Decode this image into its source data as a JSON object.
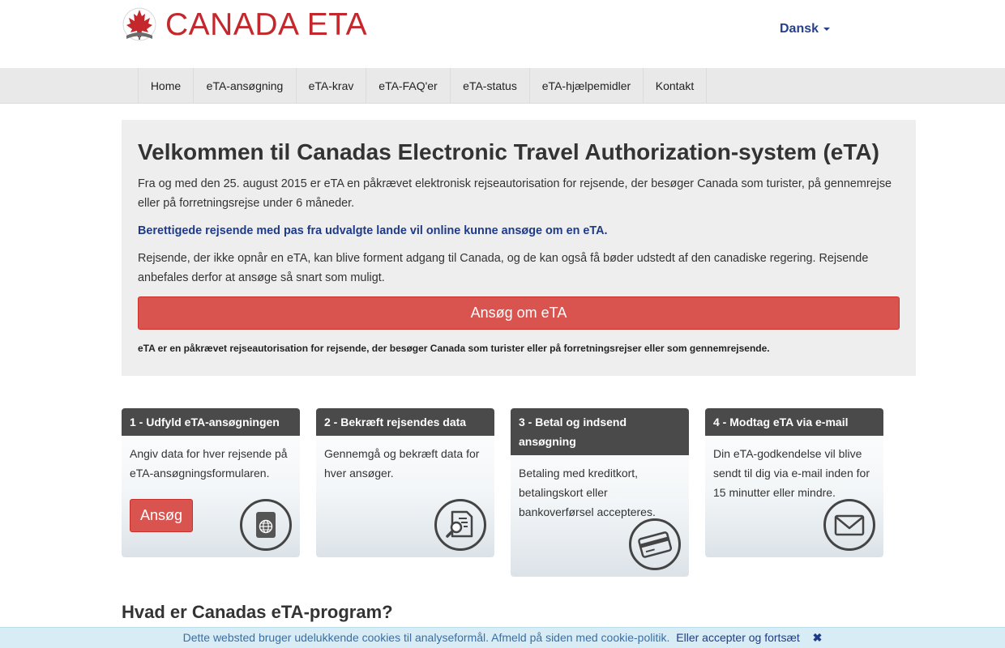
{
  "header": {
    "logo_text": "CANADA ETA",
    "language": "Dansk"
  },
  "nav": {
    "items": [
      "Home",
      "eTA-ansøgning",
      "eTA-krav",
      "eTA-FAQ'er",
      "eTA-status",
      "eTA-hjælpemidler",
      "Kontakt"
    ]
  },
  "hero": {
    "title": "Velkommen til Canadas Electronic Travel Authorization-system (eTA)",
    "p1": "Fra og med den 25. august 2015 er eTA en påkrævet elektronisk rejseautorisation for rejsende, der besøger Canada som turister, på gennemrejse eller på forretningsrejse under 6 måneder.",
    "p2": "Berettigede rejsende med pas fra udvalgte lande vil online kunne ansøge om en eTA.",
    "p3": "Rejsende, der ikke opnår en eTA, kan blive forment adgang til Canada, og de kan også få bøder udstedt af den canadiske regering. Rejsende anbefales derfor at ansøge så snart som muligt.",
    "apply_button": "Ansøg om eTA",
    "note": "eTA er en påkrævet rejseautorisation for rejsende, der besøger Canada som turister eller på forretningsrejser eller som gennemrejsende."
  },
  "steps": [
    {
      "title": "1 - Udfyld eTA-ansøgningen",
      "text": "Angiv data for hver rejsende på eTA-ansøgningsformularen.",
      "button": "Ansøg",
      "icon": "passport-icon"
    },
    {
      "title": "2 - Bekræft rejsendes data",
      "text": "Gennemgå og bekræft data for hver ansøger.",
      "icon": "document-search-icon"
    },
    {
      "title": "3 - Betal og indsend ansøgning",
      "text": "Betaling med kreditkort, betalingskort eller bankoverførsel accepteres.",
      "icon": "credit-card-icon"
    },
    {
      "title": "4 - Modtag eTA via e-mail",
      "text": "Din eTA-godkendelse vil blive sendt til dig via e-mail inden for 15 minutter eller mindre.",
      "icon": "envelope-icon"
    }
  ],
  "section_heading": "Hvad er Canadas eTA-program?",
  "cookie": {
    "text": "Dette websted bruger udelukkende cookies til analyseformål. Afmeld på siden med cookie-politik.",
    "accept": "Eller accepter og fortsæt",
    "close": "✖"
  },
  "colors": {
    "brand_red": "#c4282c",
    "button_red": "#d9534f",
    "link_blue": "#1f3b87",
    "step_header": "#4a4a4a",
    "hero_bg": "#eeeeee",
    "cookie_bg": "#d7ecf4"
  }
}
